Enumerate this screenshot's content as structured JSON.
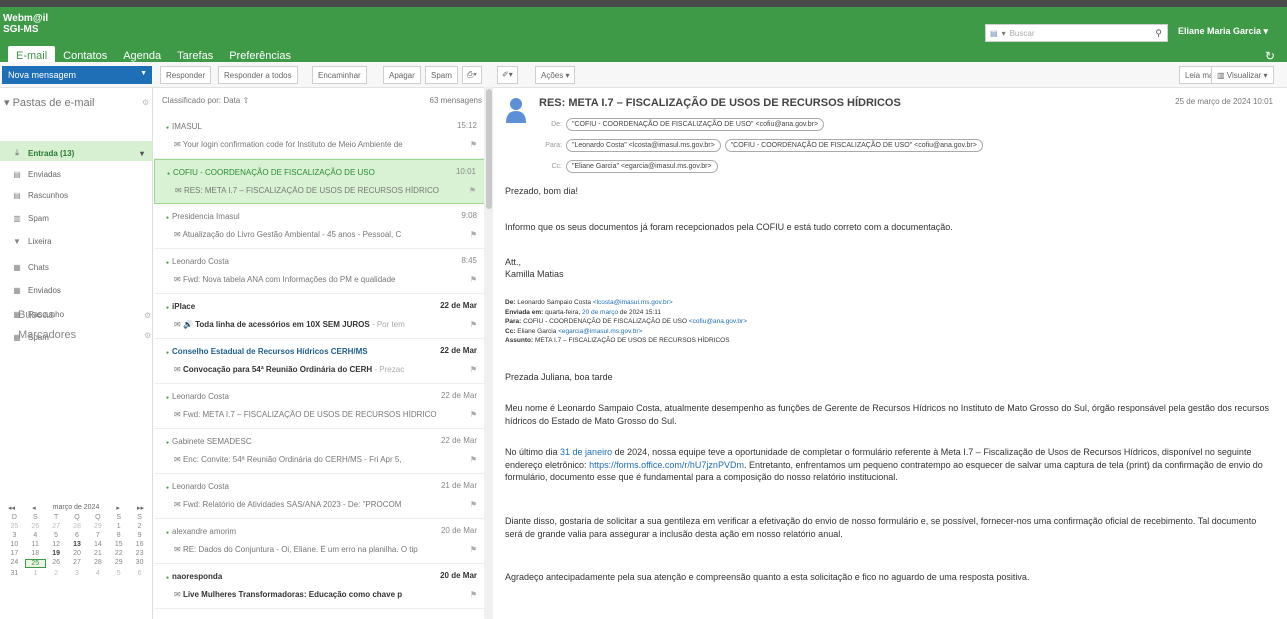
{
  "app": {
    "logo_line1": "Webm@il",
    "logo_line2": "SGI-MS",
    "user": "Eliane Maria Garcia",
    "search_placeholder": "Buscar",
    "search_scope": "▾"
  },
  "nav": {
    "tabs": [
      "E-mail",
      "Contatos",
      "Agenda",
      "Tarefas",
      "Preferências"
    ]
  },
  "toolbar": {
    "new_message": "Nova mensagem",
    "reply": "Responder",
    "reply_all": "Responder a todos",
    "forward": "Encaminhar",
    "delete": "Apagar",
    "spam": "Spam",
    "print": "▾",
    "tag": "▾",
    "actions": "Ações ▾",
    "read_more": "Leia mais",
    "view": "Visualizar ▾"
  },
  "sidebar": {
    "folders_title": "Pastas de e-mail",
    "folders": [
      {
        "label": "Entrada (13)",
        "icon": "inbox-icon"
      },
      {
        "label": "Enviadas",
        "icon": "sent-icon"
      },
      {
        "label": "Rascunhos",
        "icon": "drafts-icon"
      },
      {
        "label": "Spam",
        "icon": "spam-icon"
      },
      {
        "label": "Lixeira",
        "icon": "trash-icon"
      },
      {
        "label": "Chats",
        "icon": "chat-icon"
      },
      {
        "label": "Enviados",
        "icon": "folder-icon"
      },
      {
        "label": "Rascunho",
        "icon": "folder-icon"
      },
      {
        "label": "Spam",
        "icon": "folder-icon"
      }
    ],
    "searches": "Buscas",
    "tags": "Marcadores"
  },
  "calendar": {
    "month": "março de 2024",
    "weekdays": [
      "D",
      "S",
      "T",
      "Q",
      "Q",
      "S",
      "S"
    ],
    "days": [
      "25",
      "26",
      "27",
      "28",
      "29",
      "1",
      "2",
      "3",
      "4",
      "5",
      "6",
      "7",
      "8",
      "9",
      "10",
      "11",
      "12",
      "13",
      "14",
      "15",
      "16",
      "17",
      "18",
      "19",
      "20",
      "21",
      "22",
      "23",
      "24",
      "25",
      "26",
      "27",
      "28",
      "29",
      "30",
      "31",
      "1",
      "2",
      "3",
      "4",
      "5",
      "6"
    ]
  },
  "list": {
    "sort": "Classificado por: Data ⇧",
    "count": "63 mensagens",
    "messages": [
      {
        "from": "IMASUL",
        "time": "15:12",
        "subject": "Your login confirmation code for Instituto de Meio Ambiente de"
      },
      {
        "from": "COFIU - COORDENAÇÃO DE FISCALIZAÇÃO DE USO",
        "time": "10:01",
        "subject": "RES: META I.7 – FISCALIZAÇÃO DE USOS DE RECURSOS HÍDRICO"
      },
      {
        "from": "Presidencia Imasul",
        "time": "9:08",
        "subject": "Atualização do Livro Gestão Ambiental - 45 anos - Pessoal, C"
      },
      {
        "from": "Leonardo Costa",
        "time": "8:45",
        "subject": "Fwd: Nova tabela ANA com Informações do PM e qualidade"
      },
      {
        "from": "iPlace",
        "time": "22 de Mar",
        "subject": "Toda linha de acessórios em 10X SEM JUROS",
        "subject_extra": "- Por tem"
      },
      {
        "from": "Conselho Estadual de Recursos Hídricos CERH/MS",
        "time": "22 de Mar",
        "subject": "Convocação para 54ª Reunião Ordinária do CERH",
        "subject_extra": "- Prezac"
      },
      {
        "from": "Leonardo Costa",
        "time": "22 de Mar",
        "subject": "Fwd: META I.7 – FISCALIZAÇÃO DE USOS DE RECURSOS HÍDRICO"
      },
      {
        "from": "Gabinete SEMADESC",
        "time": "22 de Mar",
        "subject": "Enc: Convite: 54ª Reunião Ordinária do CERH/MS - Fri Apr 5,"
      },
      {
        "from": "Leonardo Costa",
        "time": "21 de Mar",
        "subject": "Fwd: Relatório de Atividades SAS/ANA 2023 - De: \"PROCOM"
      },
      {
        "from": "alexandre amorim",
        "time": "20 de Mar",
        "subject": "RE: Dados do Conjuntura - Oi, Eliane. É um erro na planilha. O tip"
      },
      {
        "from": "naoresponda",
        "time": "20 de Mar",
        "subject": "Live Mulheres Transformadoras: Educação como chave p"
      }
    ]
  },
  "reader": {
    "subject": "RES: META I.7 – FISCALIZAÇÃO DE USOS DE RECURSOS HÍDRICOS",
    "date": "25 de março de 2024 10:01",
    "de_label": "De:",
    "de": "\"COFIU - COORDENAÇÃO DE FISCALIZAÇÃO DE USO\" <cofiu@ana.gov.br>",
    "para_label": "Para:",
    "para1": "\"Leonardo Costa\" <lcosta@imasul.ms.gov.br>",
    "para2": "\"COFIU - COORDENAÇÃO DE FISCALIZAÇÃO DE USO\" <cofiu@ana.gov.br>",
    "cc_label": "Cc:",
    "cc": "\"Eliane Garcia\" <egarcia@imasul.ms.gov.br>",
    "greeting": "Prezado, bom dia!",
    "p1": "Informo que os seus documentos já foram recepcionados pela COFIU e está tudo correto com a documentação.",
    "att": "Att.,",
    "sign": "Kamilla Matias",
    "q_de_k": "De:",
    "q_de": " Leonardo Sampaio Costa ",
    "q_de_mail": "<lcosta@imasul.ms.gov.br>",
    "q_env_k": "Enviada em:",
    "q_env": " quarta-feira, ",
    "q_env_date": "20 de março",
    "q_env2": " de 2024 15:11",
    "q_para_k": "Para:",
    "q_para": " COFIU - COORDENAÇÃO DE FISCALIZAÇÃO DE USO ",
    "q_para_mail": "<cofiu@ana.gov.br>",
    "q_cc_k": "Cc:",
    "q_cc": " Eliane Garcia ",
    "q_cc_mail": "<egarcia@imasul.ms.gov.br>",
    "q_ass_k": "Assunto:",
    "q_ass": " META I.7 – FISCALIZAÇÃO DE USOS DE RECURSOS HÍDRICOS",
    "p2": "Prezada Juliana, boa tarde",
    "p3": "Meu nome é Leonardo Sampaio Costa, atualmente desempenho as funções de Gerente de Recursos Hídricos no Instituto de Mato Grosso do Sul, órgão responsável pela gestão dos recursos hídricos do Estado de Mato Grosso do Sul.",
    "p4a": "No último dia ",
    "p4_date": "31 de janeiro",
    "p4b": " de 2024, nossa equipe teve a oportunidade de completar o formulário referente à Meta I.7 – Fiscalização de Usos de Recursos Hídricos, disponível no seguinte endereço eletrônico: ",
    "p4_link": "https://forms.office.com/r/hU7jznPVDm",
    "p4c": ". Entretanto, enfrentamos um pequeno contratempo ao esquecer de salvar uma captura de tela (print) da confirmação de envio do formulário, documento esse que é fundamental para a composição do nosso relatório institucional.",
    "p5": "Diante disso, gostaria de solicitar a sua gentileza em verificar a efetivação do envio de nosso formulário e, se possível, fornecer-nos uma confirmação oficial de recebimento. Tal documento será de grande valia para assegurar a inclusão desta ação em nosso relatório anual.",
    "p6": "Agradeço antecipadamente pela sua atenção e compreensão quanto a esta solicitação e fico no aguardo de uma resposta positiva."
  },
  "colors": {
    "header": "#3e9a47",
    "accent": "#1e6fb5",
    "selected": "#d9f2d3"
  }
}
